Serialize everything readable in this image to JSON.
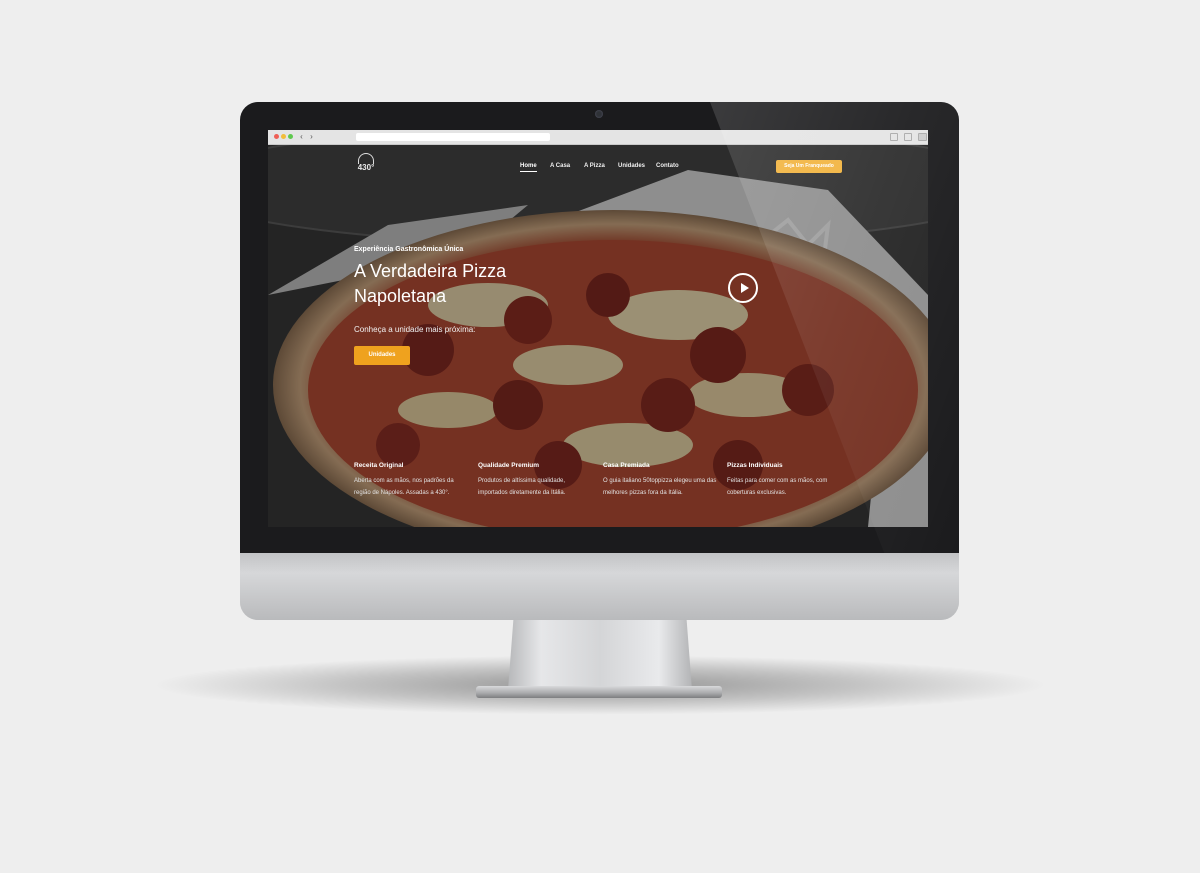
{
  "site": {
    "logo_text": "430°",
    "nav": [
      {
        "label": "Home",
        "active": true
      },
      {
        "label": "A Casa",
        "active": false
      },
      {
        "label": "A Pizza",
        "active": false
      },
      {
        "label": "Unidades",
        "active": false
      },
      {
        "label": "Contato",
        "active": false
      }
    ],
    "franchise_button": "Seja Um Franqueado"
  },
  "hero": {
    "eyebrow": "Experiência Gastronômica Única",
    "headline_line1": "A Verdadeira Pizza",
    "headline_line2": "Napoletana",
    "lead": "Conheça a unidade mais próxima:",
    "cta": "Unidades"
  },
  "features": [
    {
      "title": "Receita Original",
      "text": "Aberta com as mãos, nos padrões da região de Nápoles. Assadas a 430°."
    },
    {
      "title": "Qualidade Premium",
      "text": "Produtos de altíssima qualidade, importados diretamente da Itália."
    },
    {
      "title": "Casa Premiada",
      "text": "O guia italiano 50toppizza elegeu uma das melhores pizzas fora da Itália."
    },
    {
      "title": "Pizzas Individuais",
      "text": "Feitas para comer com as mãos, com coberturas exclusivas."
    }
  ],
  "colors": {
    "accent": "#efa21e",
    "accent_light": "#f2b33d",
    "background": "#eeeeee",
    "bezel": "#1b1b1d"
  },
  "icons": [
    "play-icon",
    "back-arrow-icon",
    "forward-arrow-icon",
    "share-icon",
    "tabs-icon"
  ]
}
